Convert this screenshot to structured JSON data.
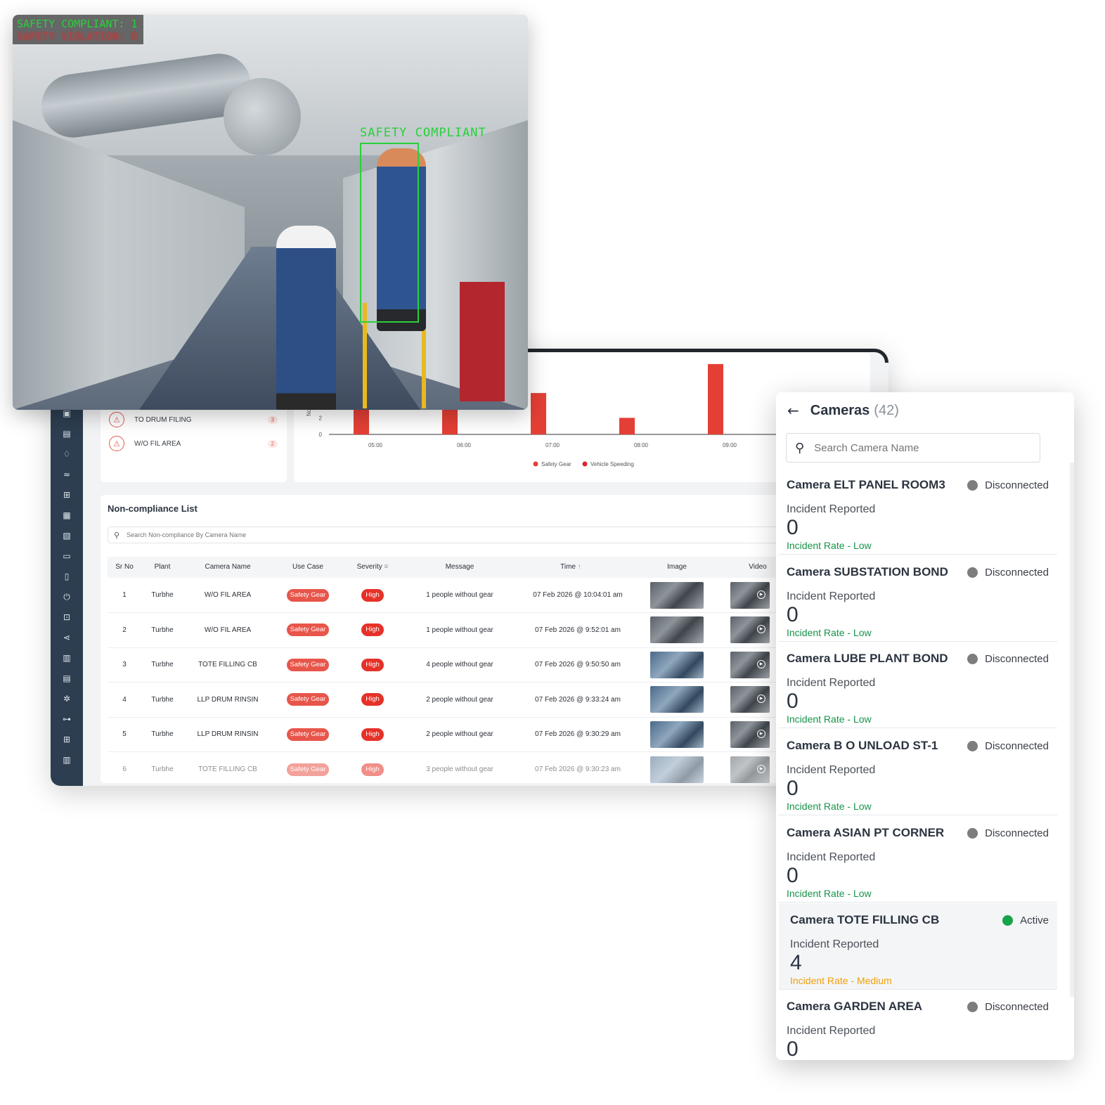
{
  "feed": {
    "hud_line1": "SAFETY COMPLIANT: 1",
    "hud_line2": "SAFETY VIOLATION: 0",
    "detection_label": "SAFETY COMPLIANT"
  },
  "locations": [
    {
      "name": "TO DRUM FILING",
      "count": "3"
    },
    {
      "name": "W/O FIL AREA",
      "count": "2"
    }
  ],
  "chart_data": {
    "type": "bar",
    "categories": [
      "05:00",
      "06:00",
      "07:00",
      "08:00",
      "09:00"
    ],
    "series": [
      {
        "name": "Safety Gear",
        "values": [
          3,
          3,
          5,
          2,
          8.5
        ]
      },
      {
        "name": "Vehicle Speeding",
        "values": [
          0,
          0,
          0,
          0,
          0
        ]
      }
    ],
    "ylabel": "Non",
    "yticks": [
      "0",
      "2"
    ],
    "ylim": [
      0,
      9
    ],
    "legend_position": "bottom",
    "colors": {
      "Safety Gear": "#e43f35",
      "Vehicle Speeding": "#d9262c"
    }
  },
  "noncompliance": {
    "title": "Non-compliance List",
    "search_placeholder": "Search Non-compliance By Camera Name",
    "columns": [
      "Sr No",
      "Plant",
      "Camera Name",
      "Use Case",
      "Severity",
      "Message",
      "Time",
      "Image",
      "Video"
    ],
    "rows": [
      {
        "sr": "1",
        "plant": "Turbhe",
        "camera": "W/O FIL AREA",
        "use_case": "Safety Gear",
        "severity": "High",
        "message": "1 people without gear",
        "time": "07 Feb 2026 @ 10:04:01 am"
      },
      {
        "sr": "2",
        "plant": "Turbhe",
        "camera": "W/O FIL AREA",
        "use_case": "Safety Gear",
        "severity": "High",
        "message": "1 people without gear",
        "time": "07 Feb 2026 @ 9:52:01 am"
      },
      {
        "sr": "3",
        "plant": "Turbhe",
        "camera": "TOTE FILLING CB",
        "use_case": "Safety Gear",
        "severity": "High",
        "message": "4 people without gear",
        "time": "07 Feb 2026 @ 9:50:50 am"
      },
      {
        "sr": "4",
        "plant": "Turbhe",
        "camera": "LLP DRUM RINSIN",
        "use_case": "Safety Gear",
        "severity": "High",
        "message": "2 people without gear",
        "time": "07 Feb 2026 @ 9:33:24 am"
      },
      {
        "sr": "5",
        "plant": "Turbhe",
        "camera": "LLP DRUM RINSIN",
        "use_case": "Safety Gear",
        "severity": "High",
        "message": "2 people without gear",
        "time": "07 Feb 2026 @ 9:30:29 am"
      },
      {
        "sr": "6",
        "plant": "Turbhe",
        "camera": "TOTE FILLING CB",
        "use_case": "Safety Gear",
        "severity": "High",
        "message": "3 people without gear",
        "time": "07 Feb 2026 @ 9:30:23 am"
      }
    ]
  },
  "cameras": {
    "title": "Cameras",
    "count": "(42)",
    "search_placeholder": "Search Camera Name",
    "incident_label": "Incident Reported",
    "colors": {
      "disconnected": "#7d7d7d",
      "active": "#17a34a",
      "low": "#17934a",
      "medium": "#f0a00a"
    },
    "items": [
      {
        "name": "Camera ELT PANEL ROOM3",
        "status": "Disconnected",
        "incidents": "0",
        "rate": "Incident Rate - Low"
      },
      {
        "name": "Camera SUBSTATION BOND",
        "status": "Disconnected",
        "incidents": "0",
        "rate": "Incident Rate - Low"
      },
      {
        "name": "Camera LUBE PLANT BOND",
        "status": "Disconnected",
        "incidents": "0",
        "rate": "Incident Rate - Low"
      },
      {
        "name": "Camera B O UNLOAD ST-1",
        "status": "Disconnected",
        "incidents": "0",
        "rate": "Incident Rate - Low"
      },
      {
        "name": "Camera ASIAN PT CORNER",
        "status": "Disconnected",
        "incidents": "0",
        "rate": "Incident Rate - Low"
      },
      {
        "name": "Camera TOTE FILLING CB",
        "status": "Active",
        "incidents": "4",
        "rate": "Incident Rate - Medium"
      },
      {
        "name": "Camera GARDEN AREA",
        "status": "Disconnected",
        "incidents": "0",
        "rate": "Incident Rate - Low"
      }
    ]
  },
  "sidebar_icons": [
    "camera-icon",
    "message-icon",
    "bell-icon",
    "trend-icon",
    "grid-icon",
    "image-icon",
    "gallery-icon",
    "monitor-icon",
    "document-icon",
    "plug-icon",
    "apps-icon",
    "share-icon",
    "report-icon",
    "clipboard-icon",
    "settings-icon",
    "hierarchy-icon",
    "dashboard-icon",
    "analytics-icon",
    "more-icon"
  ]
}
